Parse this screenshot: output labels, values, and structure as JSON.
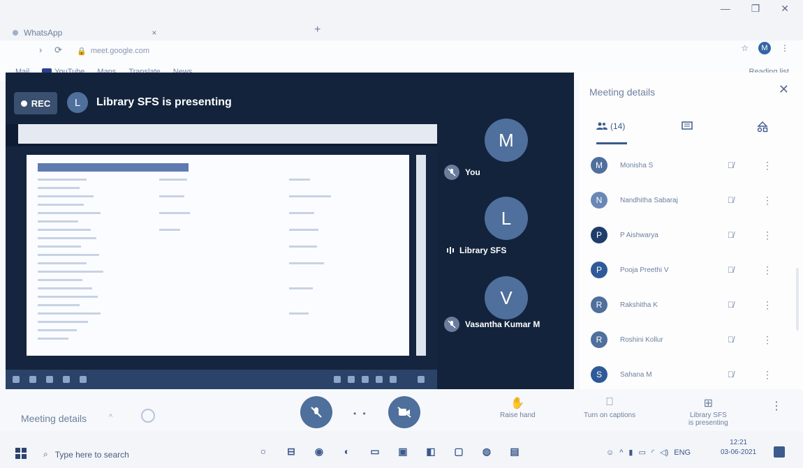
{
  "browser": {
    "tab_title": "WhatsApp",
    "new_tab": "+",
    "window_controls": [
      "—",
      "❐",
      "✕"
    ],
    "url": "meet.google.com",
    "reading_list": "Reading list",
    "profile_initial": "M",
    "bookmarks": [
      "Mail",
      "YouTube",
      "Maps",
      "Translate",
      "News"
    ]
  },
  "stage": {
    "rec_label": "REC",
    "presenter_initial": "L",
    "presenting_text": "Library SFS is presenting"
  },
  "tiles": [
    {
      "initial": "M",
      "name": "You"
    },
    {
      "initial": "L",
      "name": "Library SFS"
    },
    {
      "initial": "V",
      "name": "Vasantha Kumar M"
    }
  ],
  "panel": {
    "title": "Meeting details",
    "people_count": "(14)",
    "people": [
      {
        "initial": "M",
        "name": "Monisha S",
        "color": "#4f6f9c"
      },
      {
        "initial": "N",
        "name": "Nandhitha Sabaraj",
        "color": "#6a88b6"
      },
      {
        "initial": "P",
        "name": "P Aishwarya",
        "color": "#1f3d6b"
      },
      {
        "initial": "P",
        "name": "Pooja Preethi V",
        "color": "#2e5a98"
      },
      {
        "initial": "R",
        "name": "Rakshitha K",
        "color": "#4f6f9c"
      },
      {
        "initial": "R",
        "name": "Roshini Kollur",
        "color": "#4f6f9c"
      },
      {
        "initial": "S",
        "name": "Sahana M",
        "color": "#2e5a98"
      }
    ]
  },
  "controls": {
    "meeting_details": "Meeting details",
    "raise_hand": "Raise hand",
    "captions": "Turn on captions",
    "presenting_line1": "Library SFS",
    "presenting_line2": "is presenting"
  },
  "taskbar": {
    "search_placeholder": "Type here to search",
    "language": "ENG",
    "time": "12:21",
    "date": "03-06-2021"
  }
}
